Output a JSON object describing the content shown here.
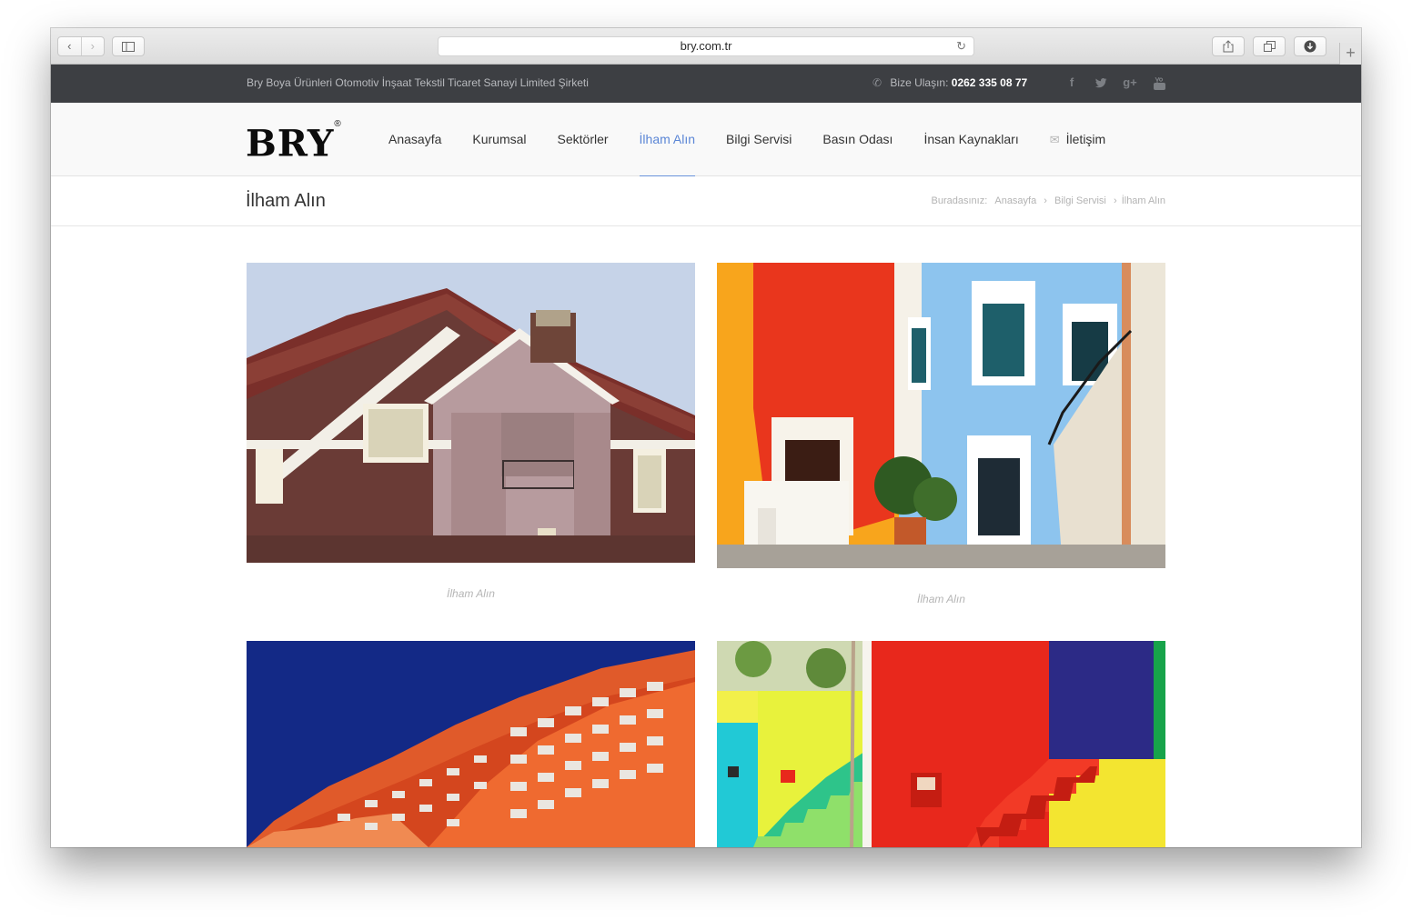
{
  "browser": {
    "url": "bry.com.tr",
    "back_icon": "chevron-left-icon",
    "forward_icon": "chevron-right-icon",
    "new_tab_label": "+"
  },
  "topbar": {
    "company": "Bry Boya Ürünleri Otomotiv İnşaat Tekstil Ticaret Sanayi Limited Şirketi",
    "contact_label": "Bize Ulaşın:",
    "phone": "0262 335 08 77",
    "social": [
      "f",
      "t",
      "g+",
      "yt"
    ]
  },
  "header": {
    "logo": "BRY",
    "logo_mark": "®",
    "nav": [
      {
        "label": "Anasayfa"
      },
      {
        "label": "Kurumsal"
      },
      {
        "label": "Sektörler"
      },
      {
        "label": "İlham Alın",
        "active": true
      },
      {
        "label": "Bilgi Servisi"
      },
      {
        "label": "Basın Odası"
      },
      {
        "label": "İnsan Kaynakları"
      },
      {
        "label": "İletişim"
      }
    ]
  },
  "page": {
    "title": "İlham Alın",
    "breadcrumb": {
      "prefix": "Buradasınız:",
      "items": [
        "Anasayfa",
        "Bilgi Servisi",
        "İlham Alın"
      ],
      "separator": "›"
    }
  },
  "gallery": [
    {
      "caption": "İlham Alın"
    },
    {
      "caption": "İlham Alın"
    },
    {
      "caption": ""
    },
    {
      "caption": ""
    }
  ],
  "colors": {
    "accent": "#5b86d6",
    "topbar_bg": "#3d3f43"
  }
}
